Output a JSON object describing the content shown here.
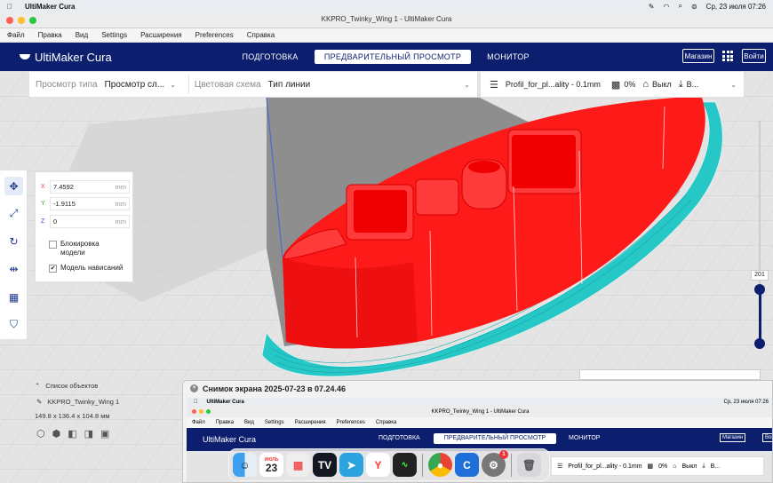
{
  "menubar": {
    "app_name": "UltiMaker Cura",
    "datetime": "Ср, 23 июля  07:26"
  },
  "window": {
    "title": "KKPRO_Twinky_Wing 1 - UltiMaker Cura"
  },
  "app_menu": [
    "Файл",
    "Правка",
    "Вид",
    "Settings",
    "Расширения",
    "Preferences",
    "Справка"
  ],
  "header": {
    "logo": "UltiMaker Cura",
    "tabs": [
      {
        "label": "ПОДГОТОВКА",
        "active": false
      },
      {
        "label": "ПРЕДВАРИТЕЛЬНЫЙ ПРОСМОТР",
        "active": true
      },
      {
        "label": "МОНИТОР",
        "active": false
      }
    ],
    "marketplace": "Магазин",
    "signin": "Войти"
  },
  "view_bar": {
    "view_type_label": "Просмотр типа",
    "view_type_value": "Просмотр сл...",
    "color_scheme_label": "Цветовая схема",
    "color_scheme_value": "Тип линии"
  },
  "print_bar": {
    "profile": "Profil_for_pl...ality - 0.1mm",
    "infill": "0%",
    "support": "Выкл",
    "adhesion": "В..."
  },
  "move_panel": {
    "x_axis": "X",
    "x_value": "7.4592",
    "x_unit": "mm",
    "y_axis": "Y",
    "y_value": "-1.9115",
    "y_unit": "mm",
    "z_axis": "Z",
    "z_value": "0",
    "z_unit": "mm",
    "lock_label": "Блокировка модели",
    "lock_checked": false,
    "drop_label": "Модель нависаний",
    "drop_checked": true
  },
  "objects": {
    "header": "Список объектов",
    "item": "KKPRO_Twinky_Wing 1",
    "dims": "149.8 x 136.4 x 104.8 мм"
  },
  "layer_slider": {
    "value": "201"
  },
  "screenshot_window": {
    "title": "Снимок экрана 2025-07-23 в 07.24.46",
    "inner_menubar_app": "UltiMaker Cura",
    "inner_datetime": "Ср, 23 июля  07:26",
    "inner_window_title": "KKPRO_Twinky_Wing 1 - UltiMaker Cura",
    "inner_menu": [
      "Файл",
      "Правка",
      "Вид",
      "Settings",
      "Расширения",
      "Preferences",
      "Справка"
    ],
    "inner_logo": "UltiMaker Cura",
    "inner_tabs": [
      "ПОДГОТОВКА",
      "ПРЕДВАРИТЕЛЬНЫЙ ПРОСМОТР",
      "МОНИТОР"
    ],
    "inner_marketplace": "Магазин",
    "inner_signin": "Войти",
    "inner_profile": "Profil_for_pl...ality - 0.1mm",
    "inner_infill": "0%",
    "inner_support": "Выкл",
    "inner_adhesion": "В..."
  },
  "dock": {
    "calendar_month": "ИЮЛЬ",
    "calendar_day": "23",
    "settings_badge": "1",
    "apps": [
      "finder",
      "calendar",
      "launchpad",
      "tradingview",
      "telegram",
      "yandex-browser",
      "activity-monitor",
      "chrome",
      "cura",
      "system-settings",
      "trash"
    ]
  },
  "colors": {
    "header_bg": "#0b1f6e",
    "model_red": "#ff1a1a",
    "skirt_cyan": "#26c7c7",
    "accent": "#1e3a8a"
  }
}
